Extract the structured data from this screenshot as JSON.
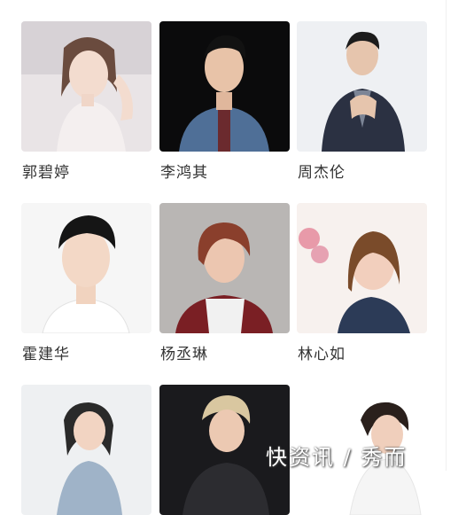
{
  "celebrities": [
    {
      "name": "郭碧婷",
      "photo": "portrait-woman-light"
    },
    {
      "name": "李鸿其",
      "photo": "portrait-man-dark"
    },
    {
      "name": "周杰伦",
      "photo": "portrait-man-suit"
    },
    {
      "name": "霍建华",
      "photo": "portrait-man-white"
    },
    {
      "name": "杨丞琳",
      "photo": "portrait-woman-grey"
    },
    {
      "name": "林心如",
      "photo": "portrait-woman-flowers"
    },
    {
      "name": "",
      "photo": "portrait-woman-light"
    },
    {
      "name": "",
      "photo": "portrait-man-dark"
    },
    {
      "name": "",
      "photo": "portrait-woman-white"
    }
  ],
  "watermark": {
    "text": "快资讯 / 秀而"
  }
}
